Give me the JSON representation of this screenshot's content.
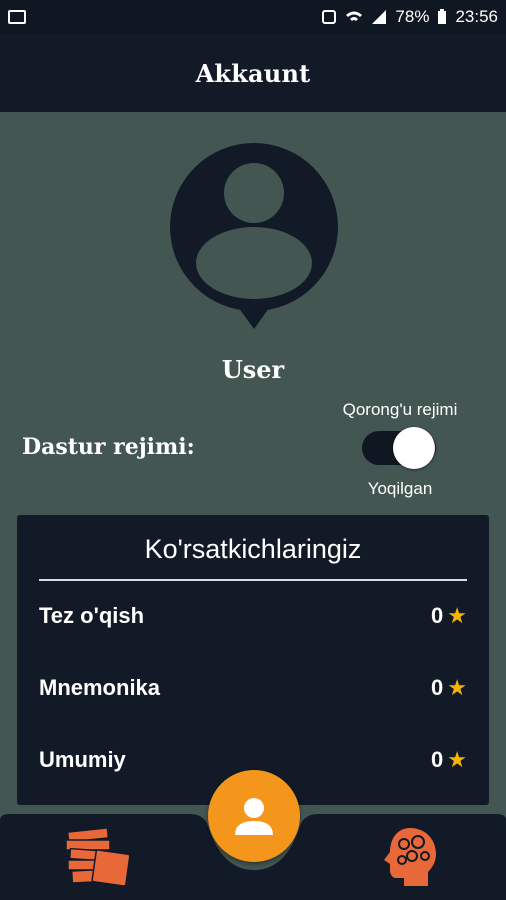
{
  "statusbar": {
    "battery": "78%",
    "time": "23:56"
  },
  "header": {
    "title": "Akkaunt"
  },
  "profile": {
    "name": "User"
  },
  "mode": {
    "label": "Dastur rejimi:",
    "toggle_title": "Qorong'u rejimi",
    "toggle_state": "Yoqilgan",
    "toggle_on": true
  },
  "stats": {
    "title": "Ko'rsatkichlaringiz",
    "rows": [
      {
        "label": "Tez o'qish",
        "value": "0"
      },
      {
        "label": "Mnemonika",
        "value": "0"
      },
      {
        "label": "Umumiy",
        "value": "0"
      }
    ]
  },
  "colors": {
    "accent": "#f5961c",
    "star": "#f6b400",
    "icon_orange": "#e8683a",
    "background": "#435651",
    "panel": "#111a26"
  },
  "nav": {
    "left_icon": "books-icon",
    "center_icon": "user-icon",
    "right_icon": "brain-gears-icon"
  }
}
